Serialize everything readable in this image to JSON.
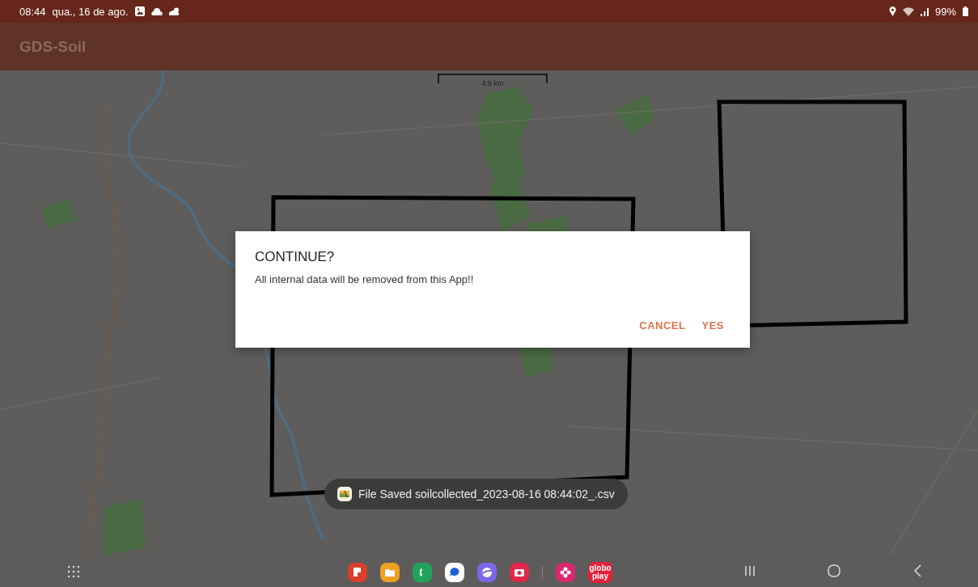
{
  "status_bar": {
    "time": "08:44",
    "date": "qua., 16 de ago.",
    "battery": "99%"
  },
  "app_bar": {
    "title": "GDS-Soil"
  },
  "map": {
    "scale_label": "4,9 km"
  },
  "dialog": {
    "title": "CONTINUE?",
    "message": "All internal data will be removed from this App!!",
    "buttons": [
      {
        "label": "CANCEL"
      },
      {
        "label": "YES"
      }
    ]
  },
  "toast": {
    "text": "File Saved soilcollected_2023-08-16 08:44:02_.csv"
  },
  "taskbar": {
    "apps": [
      {
        "kind": "notes"
      },
      {
        "kind": "files"
      },
      {
        "kind": "phone"
      },
      {
        "kind": "messages"
      },
      {
        "kind": "browser"
      },
      {
        "kind": "camera"
      },
      {
        "kind": "separator"
      },
      {
        "kind": "flower"
      },
      {
        "kind": "labelled",
        "label": "globo play"
      }
    ]
  }
}
